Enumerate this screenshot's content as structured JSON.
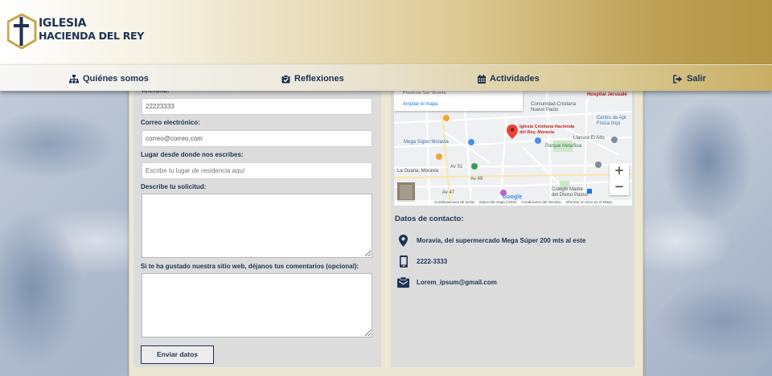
{
  "header": {
    "logo_line1": "IGLESIA",
    "logo_line2": "HACIENDA DEL REY"
  },
  "nav": {
    "items": [
      {
        "label": "Quiénes somos",
        "icon": "sitemap-icon"
      },
      {
        "label": "Reflexiones",
        "icon": "clipboard-icon"
      },
      {
        "label": "Actividades",
        "icon": "calendar-icon"
      },
      {
        "label": "Salir",
        "icon": "sign-out-icon"
      }
    ]
  },
  "form": {
    "phone_label": "Teléfono:",
    "phone_value": "22223333",
    "email_label": "Correo electrónico:",
    "email_value": "correo@correo.com",
    "location_label": "Lugar desde donde nos escribes:",
    "location_placeholder": "Escribe tu lugar de residencia aquí",
    "request_label": "Describe tu solicitud:",
    "comments_label": "Si te ha gustado nuestra sitio web, déjanos tus comentarios (opcional):",
    "submit_label": "Enviar datos"
  },
  "map": {
    "location_text": "Provincia San Vicente",
    "enlarge_link": "Ampliar el mapa",
    "labels": {
      "hospital": "Hospital Jerusalé",
      "comunidad": "Comunidad Cristiana\nNuevo Pacto",
      "iglesia": "Iglesia Cristiana Hacienda\ndel Rey, Moravia",
      "centro": "Centro de Apt\nFísica Impi",
      "mega": "Mega Súper Moravia",
      "llanura": "Llanura El Alto",
      "parque": "Parque MetaSua",
      "guaria": "La Guaria, Moravia",
      "colegio": "Colegio Madre\ndel Divino Pastor",
      "av51": "Av 51",
      "av49": "Av 49",
      "av47": "Av 47"
    },
    "footer": [
      "Combinaciones de teclas",
      "Datos del mapa ©2022",
      "Condiciones del Servicio",
      "Informar un error en el Mapa"
    ],
    "zoom_in": "+",
    "zoom_out": "−"
  },
  "contact": {
    "title": "Datos de contacto:",
    "address": "Moravia, del supermercado Mega Súper 200 mts al este",
    "phone": "2222-3333",
    "email": "Lorem_ipsum@gmail.com"
  },
  "colors": {
    "brand_navy": "#1d3352",
    "gold": "#b49545"
  }
}
